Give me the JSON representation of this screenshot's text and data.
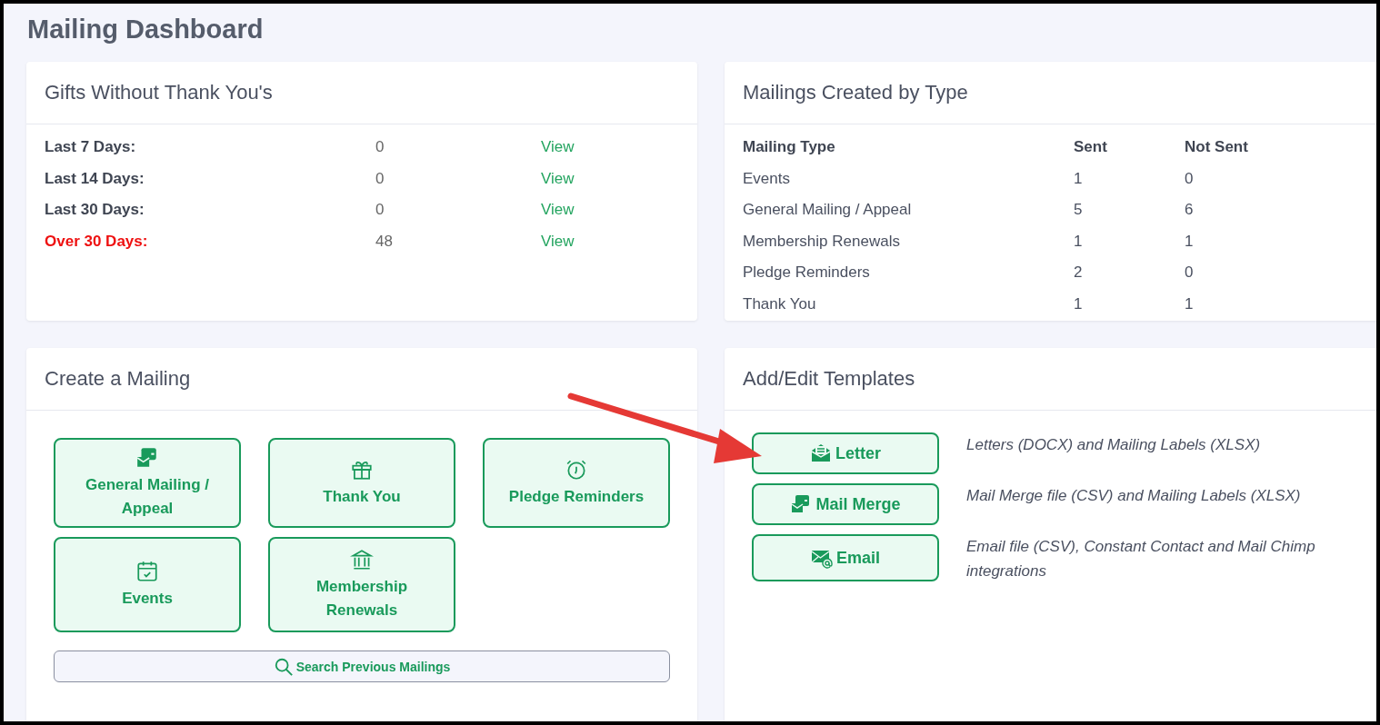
{
  "title": "Mailing Dashboard",
  "gifts": {
    "title": "Gifts Without Thank You's",
    "rows": [
      {
        "label": "Last 7 Days:",
        "count": "0",
        "link": "View",
        "overdue": false
      },
      {
        "label": "Last 14 Days:",
        "count": "0",
        "link": "View",
        "overdue": false
      },
      {
        "label": "Last 30 Days:",
        "count": "0",
        "link": "View",
        "overdue": false
      },
      {
        "label": "Over 30 Days:",
        "count": "48",
        "link": "View",
        "overdue": true
      }
    ]
  },
  "mailings": {
    "title": "Mailings Created by Type",
    "columns": [
      "Mailing Type",
      "Sent",
      "Not Sent"
    ],
    "rows": [
      [
        "Events",
        "1",
        "0"
      ],
      [
        "General Mailing / Appeal",
        "5",
        "6"
      ],
      [
        "Membership Renewals",
        "1",
        "1"
      ],
      [
        "Pledge Reminders",
        "2",
        "0"
      ],
      [
        "Thank You",
        "1",
        "1"
      ]
    ]
  },
  "create": {
    "title": "Create a Mailing",
    "buttons": [
      {
        "label": "General Mailing / Appeal",
        "kind": "mailbox"
      },
      {
        "label": "Thank You",
        "kind": "gift"
      },
      {
        "label": "Pledge Reminders",
        "kind": "alarm"
      },
      {
        "label": "Events",
        "kind": "calendar"
      },
      {
        "label": "Membership Renewals",
        "kind": "bank"
      }
    ],
    "search": "Search Previous Mailings"
  },
  "templates": {
    "title": "Add/Edit Templates",
    "items": [
      {
        "label": "Letter",
        "kind": "letter",
        "description": "Letters (DOCX) and Mailing Labels (XLSX)"
      },
      {
        "label": "Mail Merge",
        "kind": "mailbox",
        "description": "Mail Merge file (CSV) and Mailing Labels (XLSX)"
      },
      {
        "label": "Email",
        "kind": "email",
        "description": "Email file (CSV), Constant Contact and Mail Chimp integrations"
      }
    ]
  }
}
